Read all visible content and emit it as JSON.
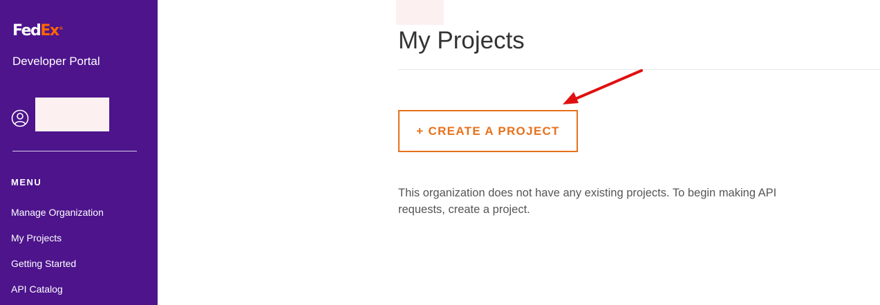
{
  "sidebar": {
    "logo": {
      "fed": "Fed",
      "ex": "Ex",
      "reg": "®"
    },
    "portal_title": "Developer Portal",
    "menu_heading": "MENU",
    "items": [
      {
        "label": "Manage Organization"
      },
      {
        "label": "My Projects"
      },
      {
        "label": "Getting Started"
      },
      {
        "label": "API Catalog"
      }
    ]
  },
  "main": {
    "title": "My Projects",
    "create_button_label": "+ CREATE A PROJECT",
    "empty_message": "This organization does not have any existing projects. To begin making API requests, create a project."
  },
  "colors": {
    "sidebar_bg": "#4d148c",
    "accent_orange": "#e8701a",
    "annotation_red": "#e01010"
  },
  "icons": {
    "user": "user-circle-icon",
    "annotation": "red-arrow-annotation"
  }
}
